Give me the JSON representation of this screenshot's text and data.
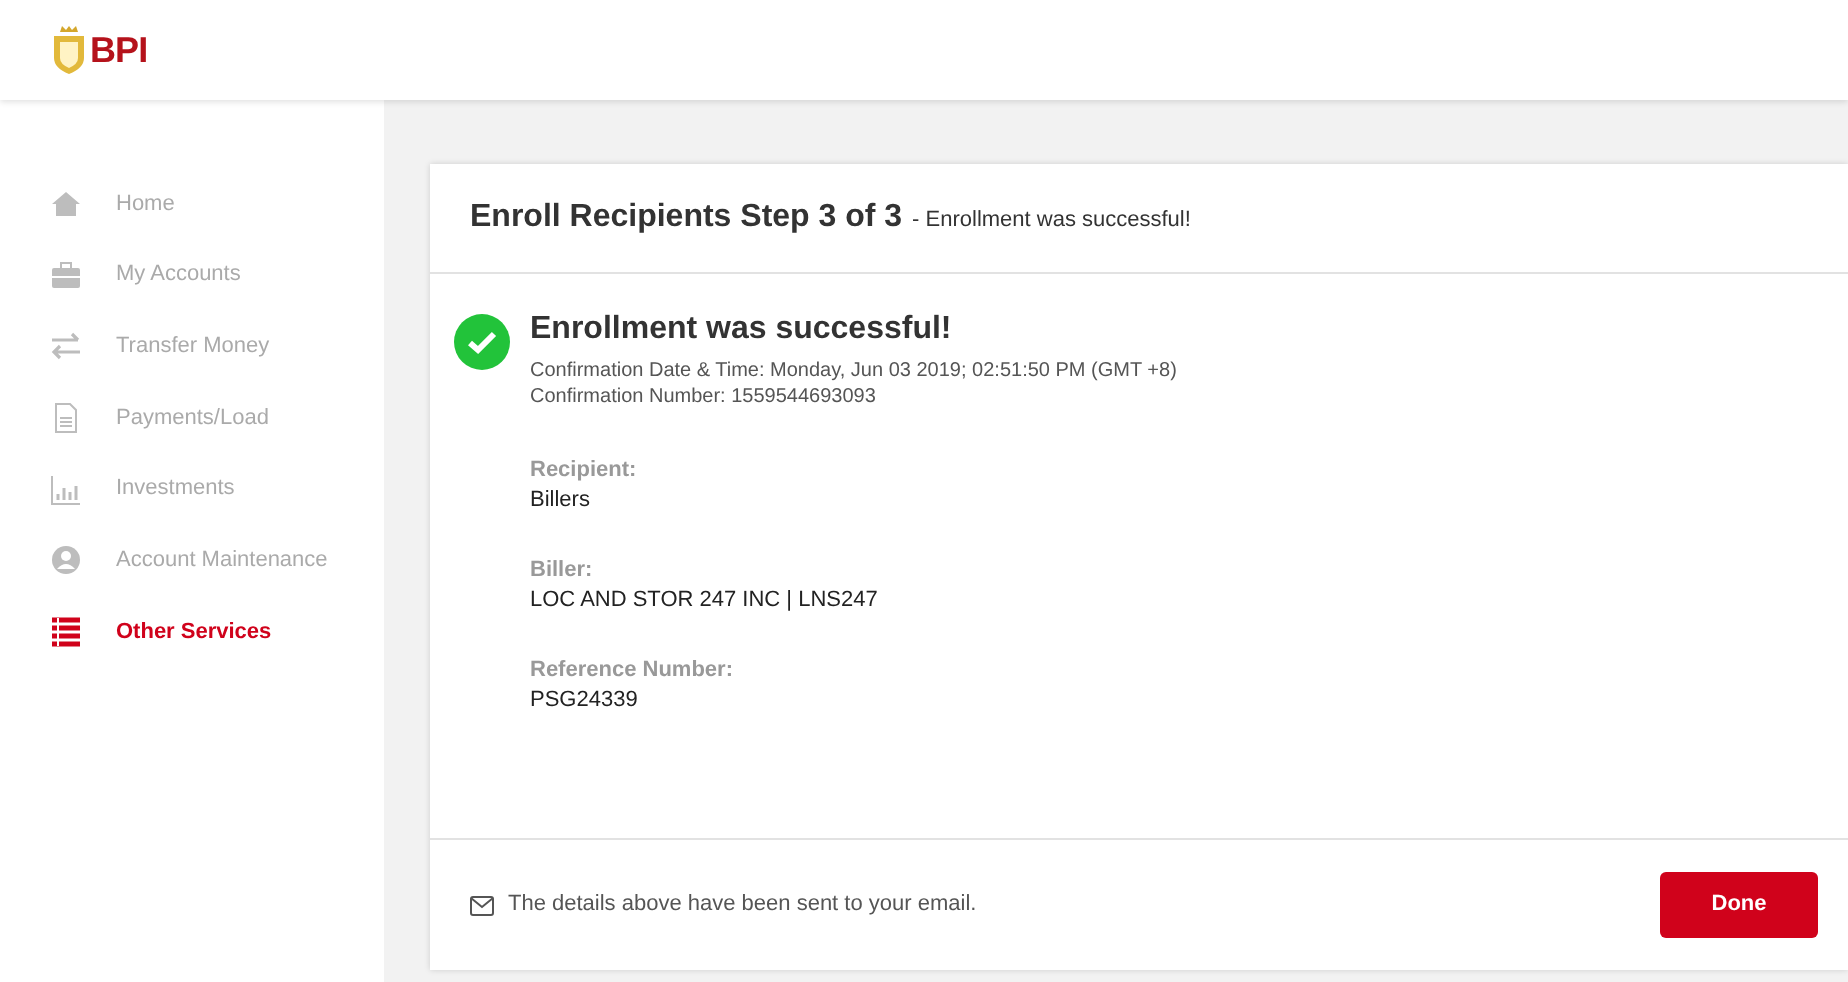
{
  "header": {
    "logo_text": "BPI"
  },
  "sidebar": {
    "items": [
      {
        "label": "Home",
        "selected": false
      },
      {
        "label": "My Accounts",
        "selected": false
      },
      {
        "label": "Transfer Money",
        "selected": false
      },
      {
        "label": "Payments/Load",
        "selected": false
      },
      {
        "label": "Investments",
        "selected": false
      },
      {
        "label": "Account Maintenance",
        "selected": false
      },
      {
        "label": "Other Services",
        "selected": true
      }
    ]
  },
  "card": {
    "title": "Enroll Recipients Step 3 of 3",
    "subtitle": "- Enrollment was successful!",
    "status": {
      "heading": "Enrollment was successful!",
      "lines": [
        "Confirmation Date & Time: Monday, Jun 03 2019; 02:51:50 PM (GMT +8)",
        "Confirmation Number: 1559544693093"
      ]
    },
    "fields": [
      {
        "label": "Recipient:",
        "value": "Billers"
      },
      {
        "label": "Biller:",
        "value": "LOC AND STOR 247 INC | LNS247"
      },
      {
        "label": "Reference Number:",
        "value": "PSG24339"
      }
    ],
    "footer_note": "The details above have been sent to your email.",
    "done_button": "Done"
  }
}
